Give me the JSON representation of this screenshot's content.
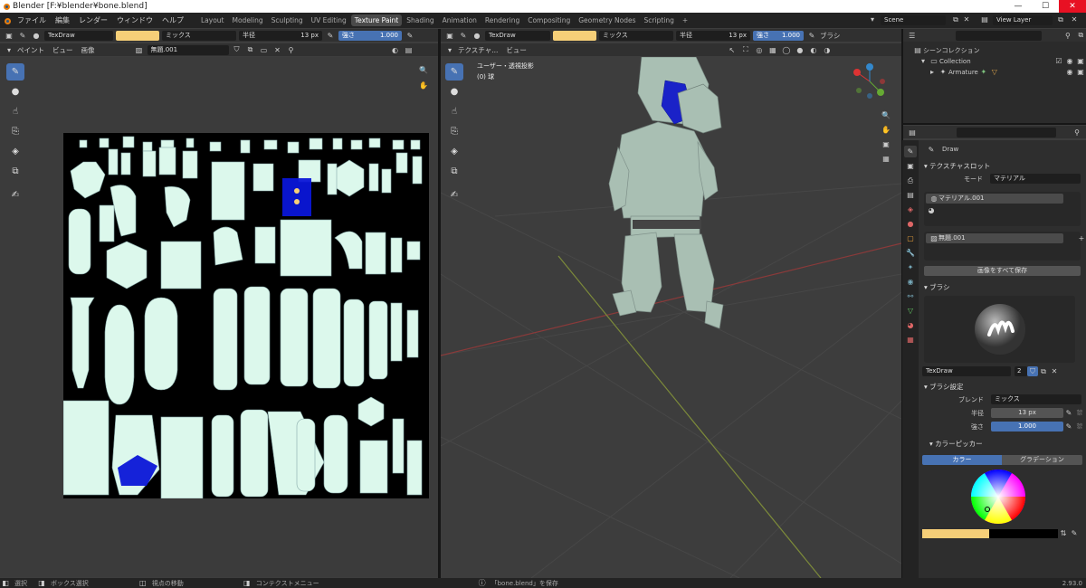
{
  "window": {
    "title": "Blender [F:¥blender¥bone.blend]",
    "controls": [
      "—",
      "☐",
      "✕"
    ]
  },
  "menu": {
    "items": [
      "ファイル",
      "編集",
      "レンダー",
      "ウィンドウ",
      "ヘルプ"
    ],
    "tabs": [
      "Layout",
      "Modeling",
      "Sculpting",
      "UV Editing",
      "Texture Paint",
      "Shading",
      "Animation",
      "Rendering",
      "Compositing",
      "Geometry Nodes",
      "Scripting"
    ],
    "active_tab": "Texture Paint",
    "scene": "Scene",
    "view_layer": "View Layer",
    "add": "+"
  },
  "image_editor": {
    "brush": "TexDraw",
    "color": "#f6cf78",
    "blend": "ミックス",
    "radius_label": "半径",
    "radius": "13 px",
    "strength_label": "強さ",
    "strength": "1.000",
    "mode": "ペイント",
    "view": "ビュー",
    "image_menu": "画像",
    "image_name": "無題.001",
    "tools": [
      "brush",
      "drop",
      "smear",
      "clone",
      "fill",
      "mask",
      "annotate"
    ]
  },
  "viewport": {
    "mode": "テクスチャ...",
    "view": "ビュー",
    "brush": "TexDraw",
    "color": "#f6cf78",
    "blend": "ミックス",
    "radius_label": "半径",
    "radius": "13 px",
    "strength_label": "強さ",
    "strength": "1.000",
    "brush_menu": "ブラシ",
    "overlay_title": "ユーザー・透視投影",
    "overlay_sub": "(0) 球"
  },
  "outliner": {
    "title": "シーンコレクション",
    "items": [
      {
        "label": "Collection"
      },
      {
        "label": "Armature"
      }
    ]
  },
  "properties": {
    "tool_name": "Draw",
    "texture_slots": {
      "title": "テクスチャスロット",
      "mode_label": "モード",
      "mode": "マテリアル",
      "material": "マテリアル.001",
      "image": "無題.001",
      "save_all": "画像をすべて保存"
    },
    "brush": {
      "title": "ブラシ",
      "name": "TexDraw",
      "users": "2"
    },
    "brush_settings": {
      "title": "ブラシ設定",
      "blend_label": "ブレンド",
      "blend": "ミックス",
      "radius_label": "半径",
      "radius": "13 px",
      "strength_label": "強さ",
      "strength": "1.000"
    },
    "color_picker": {
      "title": "カラーピッカー",
      "tab_color": "カラー",
      "tab_gradient": "グラデーション"
    }
  },
  "status": {
    "select": "選択",
    "box_select": "ボックス選択",
    "pan": "視点の移動",
    "context_menu": "コンテクストメニュー",
    "message": "「bone.blend」を保存",
    "version": "2.93.0"
  }
}
